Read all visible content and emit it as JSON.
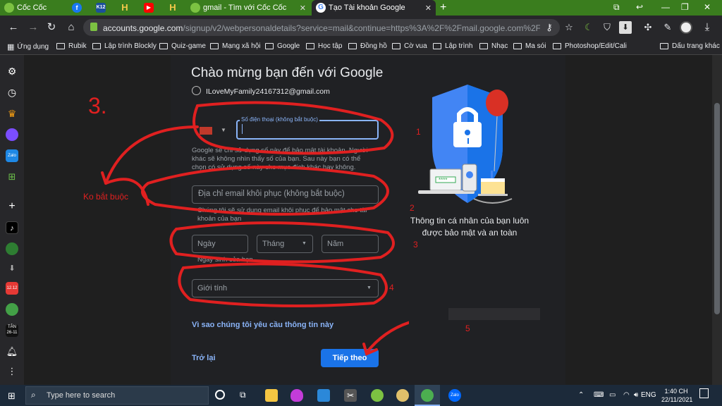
{
  "browser": {
    "tabs": [
      {
        "label": "Cốc Cốc",
        "icon": "coccoc-logo-icon"
      },
      {
        "label": "",
        "icon": "facebook-icon"
      },
      {
        "label": "K12",
        "icon": "k12-icon"
      },
      {
        "label": "H",
        "icon": "hoc-icon"
      },
      {
        "label": "",
        "icon": "youtube-icon"
      },
      {
        "label": "H",
        "icon": "hoc-icon"
      },
      {
        "label": "gmail - Tìm với Cốc Cốc",
        "icon": "coccoc-search-icon"
      },
      {
        "label": "Tạo Tài khoản Google",
        "icon": "google-icon",
        "active": true
      }
    ],
    "url_main": "accounts.google.com",
    "url_rest": "/signup/v2/webpersonaldetails?service=mail&continue=https%3A%2F%2Fmail.google.com%2Fmail%2F&flow...",
    "bookmarks": [
      "Ứng dụng",
      "Rubik",
      "Lập trình Blockly",
      "Quiz-game",
      "Mạng xã hội",
      "Google",
      "Học tập",
      "Đồng hồ",
      "Cờ vua",
      "Lập trình",
      "Nhạc",
      "Ma sói",
      "Photoshop/Edit/Cali",
      "Dấu trang khác"
    ]
  },
  "form": {
    "title": "Chào mừng bạn đến với Google",
    "account_email": "ILoveMyFamily24167312@gmail.com",
    "phone_label": "Số điện thoại (không bắt buộc)",
    "phone_help": "Google sẽ chỉ sử dụng số này để bảo mật tài khoản. Người khác sẽ không nhìn thấy số của bạn. Sau này bạn có thể chọn có sử dụng số này cho mục đích khác hay không.",
    "recovery_placeholder": "Địa chỉ email khôi phục (không bắt buộc)",
    "recovery_help": "Chúng tôi sẽ sử dụng email khôi phục để bảo mật cho tài khoản của bạn",
    "day_placeholder": "Ngày",
    "month_placeholder": "Tháng",
    "year_placeholder": "Năm",
    "birthday_help": "Ngày sinh của bạn",
    "gender_placeholder": "Giới tính",
    "why_link": "Vì sao chúng tôi yêu cầu thông tin này",
    "back_label": "Trở lại",
    "next_label": "Tiếp theo",
    "illustration_caption_1": "Thông tin cá nhân của bạn luôn",
    "illustration_caption_2": "được bảo mật và an toàn",
    "illustration_pin": "****"
  },
  "annotations": {
    "step": "3.",
    "optional_note": "Ko bắt buộc",
    "n1": "1",
    "n2": "2",
    "n3": "3",
    "n4": "4",
    "n5": "5",
    "color": "#e02020"
  },
  "taskbar": {
    "search_placeholder": "Type here to search",
    "lang": "ENG",
    "time": "1:40 CH",
    "date": "22/11/2021"
  }
}
